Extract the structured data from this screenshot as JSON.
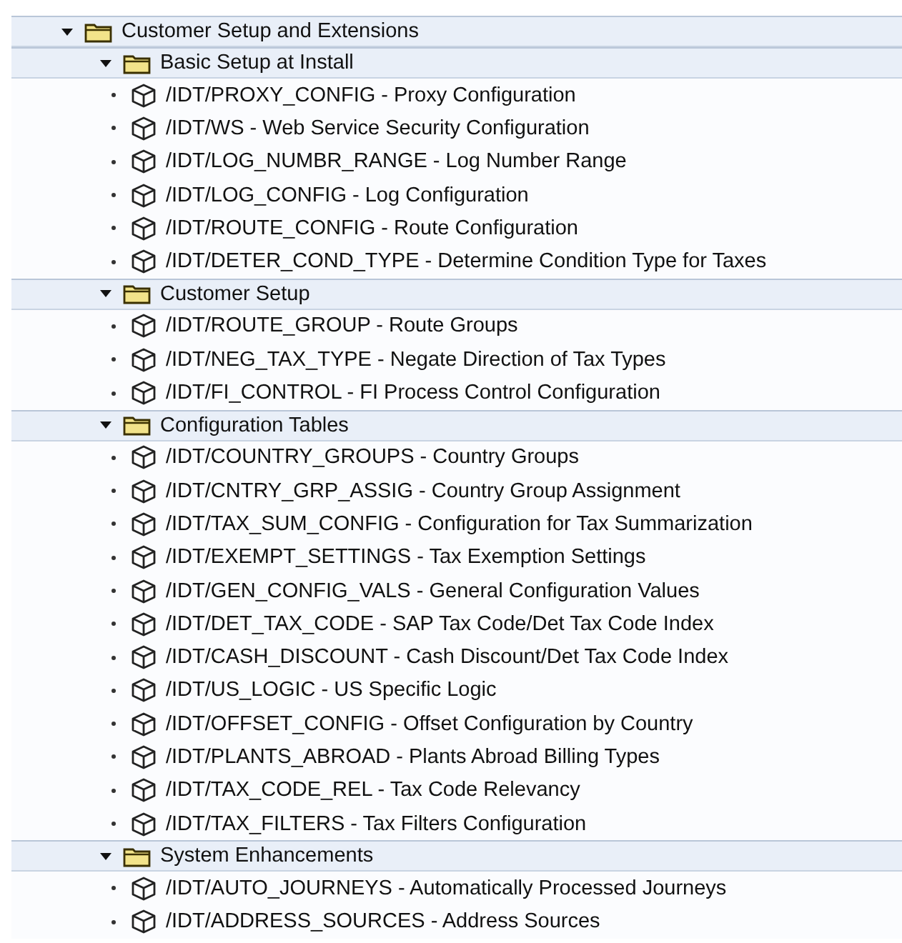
{
  "tree": [
    {
      "kind": "folder",
      "label": "Customer Setup and Extensions",
      "expanded": true,
      "children": [
        {
          "kind": "folder",
          "label": "Basic Setup at Install",
          "expanded": true,
          "children": [
            {
              "kind": "item",
              "label": "/IDT/PROXY_CONFIG - Proxy Configuration"
            },
            {
              "kind": "item",
              "label": "/IDT/WS - Web Service Security Configuration"
            },
            {
              "kind": "item",
              "label": "/IDT/LOG_NUMBR_RANGE - Log Number Range"
            },
            {
              "kind": "item",
              "label": "/IDT/LOG_CONFIG - Log Configuration"
            },
            {
              "kind": "item",
              "label": "/IDT/ROUTE_CONFIG - Route Configuration"
            },
            {
              "kind": "item",
              "label": "/IDT/DETER_COND_TYPE - Determine Condition Type for Taxes"
            }
          ]
        },
        {
          "kind": "folder",
          "label": "Customer Setup",
          "expanded": true,
          "children": [
            {
              "kind": "item",
              "label": "/IDT/ROUTE_GROUP - Route Groups"
            },
            {
              "kind": "item",
              "label": "/IDT/NEG_TAX_TYPE - Negate Direction of Tax Types"
            },
            {
              "kind": "item",
              "label": "/IDT/FI_CONTROL - FI Process Control Configuration"
            }
          ]
        },
        {
          "kind": "folder",
          "label": "Configuration Tables",
          "expanded": true,
          "children": [
            {
              "kind": "item",
              "label": "/IDT/COUNTRY_GROUPS - Country Groups"
            },
            {
              "kind": "item",
              "label": "/IDT/CNTRY_GRP_ASSIG - Country Group Assignment"
            },
            {
              "kind": "item",
              "label": "/IDT/TAX_SUM_CONFIG - Configuration for Tax Summarization"
            },
            {
              "kind": "item",
              "label": "/IDT/EXEMPT_SETTINGS - Tax Exemption Settings"
            },
            {
              "kind": "item",
              "label": "/IDT/GEN_CONFIG_VALS - General Configuration Values"
            },
            {
              "kind": "item",
              "label": "/IDT/DET_TAX_CODE - SAP Tax Code/Det Tax Code Index"
            },
            {
              "kind": "item",
              "label": "/IDT/CASH_DISCOUNT - Cash Discount/Det Tax Code Index"
            },
            {
              "kind": "item",
              "label": "/IDT/US_LOGIC - US Specific Logic"
            },
            {
              "kind": "item",
              "label": "/IDT/OFFSET_CONFIG - Offset Configuration by Country"
            },
            {
              "kind": "item",
              "label": "/IDT/PLANTS_ABROAD - Plants Abroad Billing Types"
            },
            {
              "kind": "item",
              "label": "/IDT/TAX_CODE_REL - Tax Code Relevancy"
            },
            {
              "kind": "item",
              "label": "/IDT/TAX_FILTERS - Tax Filters Configuration"
            }
          ]
        },
        {
          "kind": "folder",
          "label": "System Enhancements",
          "expanded": true,
          "children": [
            {
              "kind": "item",
              "label": "/IDT/AUTO_JOURNEYS - Automatically Processed Journeys"
            },
            {
              "kind": "item",
              "label": "/IDT/ADDRESS_SOURCES - Address Sources"
            }
          ]
        }
      ]
    }
  ]
}
